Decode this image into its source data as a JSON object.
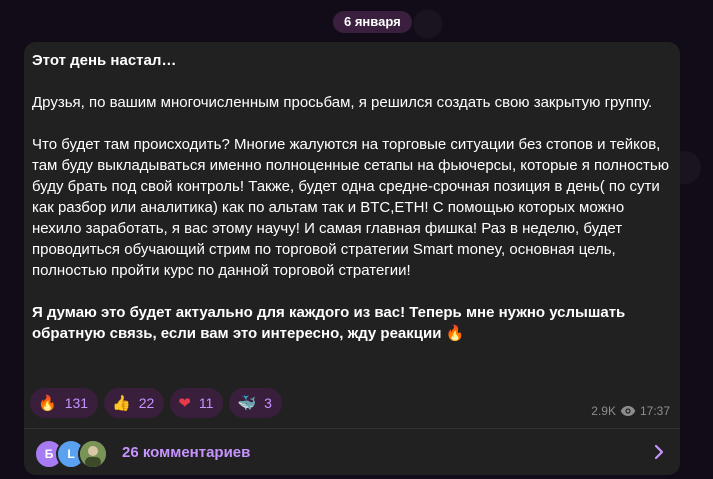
{
  "date_label": "6 января",
  "message": {
    "title": "Этот день настал…",
    "para1": "Друзья, по вашим многочисленным просьбам, я решился создать свою закрытую группу.",
    "para2": "Что будет там происходить? Многие жалуются на торговые ситуации без стопов и тейков, там буду выкладываться именно полноценные сетапы на фьючерсы, которые я полностью буду брать под свой контроль! Также, будет одна средне-срочная позиция в день( по сути как разбор или аналитика) как по альтам так и BTC,ETH! С помощью которых можно нехило заработать, я вас этому научу! И самая главная фишка! Раз в неделю, будет проводиться обучающий стрим по торговой стратегии Smart money, основная цель, полностью пройти курс по данной торговой стратегии!",
    "para3": "Я думаю это будет актуально для каждого из вас! Теперь мне нужно услышать обратную связь, если вам это интересно, жду реакции 🔥"
  },
  "reactions": [
    {
      "emoji": "🔥",
      "count": "131"
    },
    {
      "emoji": "👍",
      "count": "22"
    },
    {
      "emoji": "❤",
      "count": "11"
    },
    {
      "emoji": "🐳",
      "count": "3"
    }
  ],
  "meta": {
    "views": "2.9K",
    "time": "17:37"
  },
  "comments": {
    "avatars": [
      "Б",
      "L"
    ],
    "label": "26 комментариев"
  },
  "colors": {
    "accent": "#c694ff",
    "bubble": "#212121",
    "reaction_bg": "#3a1f3d"
  }
}
